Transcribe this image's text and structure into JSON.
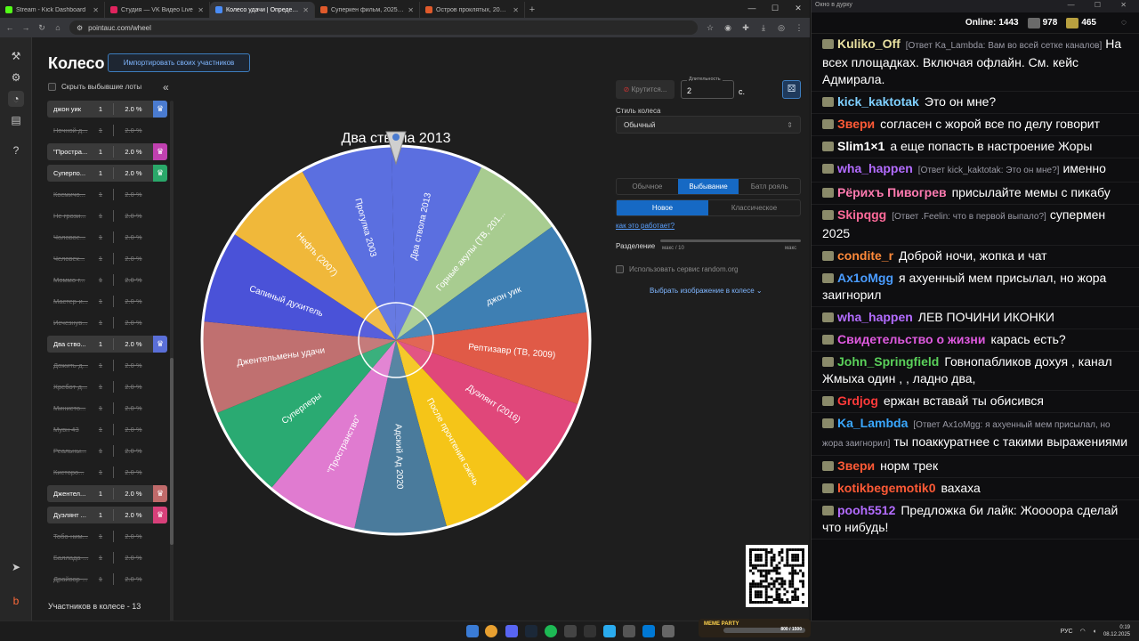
{
  "browser": {
    "tabs": [
      {
        "title": "Stream - Kick Dashboard",
        "color": "#53fc18"
      },
      {
        "title": "Студия — VK Видео Live",
        "color": "#e0245e"
      },
      {
        "title": "Колесо удачи | Определите по",
        "color": "#4a8cf7",
        "active": true
      },
      {
        "title": "Суперкен фильм, 2025, дата в",
        "color": "#e05a2b"
      },
      {
        "title": "Остров проклятых, 2009 — сю",
        "color": "#e05a2b"
      }
    ],
    "url": "pointauc.com/wheel"
  },
  "page": {
    "title": "Колесо",
    "import_button": "Импортировать своих участников",
    "hide_winners": "Скрыть выбывшие лоты",
    "footer": "Участников в колесе - 13",
    "participants": [
      {
        "name": "джон уик",
        "count": "1",
        "percent": "2.0 %",
        "active": true,
        "tag_color": "#4a7bd0"
      },
      {
        "name": "Ночной д...",
        "count": "1",
        "percent": "2.0 %",
        "active": false
      },
      {
        "name": "\"Простра...",
        "count": "1",
        "percent": "2.0 %",
        "active": true,
        "tag_color": "#c040b0"
      },
      {
        "name": "Суперпо...",
        "count": "1",
        "percent": "2.0 %",
        "active": true,
        "tag_color": "#2aa86a"
      },
      {
        "name": "Космичо...",
        "count": "1",
        "percent": "2.0 %",
        "active": false
      },
      {
        "name": "Не грози...",
        "count": "1",
        "percent": "2.0 %",
        "active": false
      },
      {
        "name": "Чоловое...",
        "count": "1",
        "percent": "2.0 %",
        "active": false
      },
      {
        "name": "Человек...",
        "count": "1",
        "percent": "2.0 %",
        "active": false
      },
      {
        "name": "Моммо-г...",
        "count": "1",
        "percent": "2.0 %",
        "active": false
      },
      {
        "name": "Мастер-и...",
        "count": "1",
        "percent": "2.0 %",
        "active": false
      },
      {
        "name": "Исчезнув...",
        "count": "1",
        "percent": "2.0 %",
        "active": false
      },
      {
        "name": "Два ство...",
        "count": "1",
        "percent": "2.0 %",
        "active": true,
        "tag_color": "#5a6fd8"
      },
      {
        "name": "Дожить-д...",
        "count": "1",
        "percent": "2.0 %",
        "active": false
      },
      {
        "name": "Хребот-д...",
        "count": "1",
        "percent": "2.0 %",
        "active": false
      },
      {
        "name": "Министо...",
        "count": "1",
        "percent": "2.0 %",
        "active": false
      },
      {
        "name": "Мувн 43",
        "count": "1",
        "percent": "2.0 %",
        "active": false
      },
      {
        "name": "Реальны...",
        "count": "1",
        "percent": "2.0 %",
        "active": false
      },
      {
        "name": "Кисторо...",
        "count": "1",
        "percent": "2.0 %",
        "active": false
      },
      {
        "name": "Джентел...",
        "count": "1",
        "percent": "2.0 %",
        "active": true,
        "tag_color": "#c06a6a"
      },
      {
        "name": "Дуэлянт ...",
        "count": "1",
        "percent": "2.0 %",
        "active": true,
        "tag_color": "#d8407a"
      },
      {
        "name": "Тобо-ним...",
        "count": "1",
        "percent": "2.0 %",
        "active": false
      },
      {
        "name": "Баллада-...",
        "count": "1",
        "percent": "2.0 %",
        "active": false
      },
      {
        "name": "Драйвор-...",
        "count": "1",
        "percent": "2.0 %",
        "active": false
      }
    ]
  },
  "wheel": {
    "title": "Два ствола 2013",
    "segments": [
      {
        "label": "Два ствола 2013",
        "color": "#5b6fe0"
      },
      {
        "label": "Горные акулы (ТВ, 201...",
        "color": "#a8cc90"
      },
      {
        "label": "джон уик",
        "color": "#3e7fb3"
      },
      {
        "label": "Рептизавр (ТВ, 2009)",
        "color": "#e05a47"
      },
      {
        "label": "Дуэлянт (2016)",
        "color": "#e0477a"
      },
      {
        "label": "После прочтения сжечь",
        "color": "#f5c518"
      },
      {
        "label": "Адский Ад 2020",
        "color": "#4a7b9c"
      },
      {
        "label": "\"Пространство\"",
        "color": "#e07bd0"
      },
      {
        "label": "Суперперы",
        "color": "#2aaa72"
      },
      {
        "label": "Джентельмены удачи",
        "color": "#c07070"
      },
      {
        "label": "Сапиный духитель",
        "color": "#4a52d8"
      },
      {
        "label": "Нефть (2007)",
        "color": "#f0b83a"
      },
      {
        "label": "Прогулка 2003",
        "color": "#5b6fe0"
      }
    ]
  },
  "controls": {
    "spin": "Крутится...",
    "duration_label": "Длительность",
    "duration_value": "2",
    "seconds": "с.",
    "style_label": "Стиль колеса",
    "style_value": "Обычный",
    "mode_tabs": [
      "Обычное",
      "Выбывание",
      "Батл рояль"
    ],
    "mode_selected": 1,
    "variant_tabs": [
      "Новое",
      "Классическое"
    ],
    "variant_selected": 0,
    "how_link": "как это работает?",
    "split_label": "Разделение",
    "split_min": "макс / 10",
    "split_max": "макс",
    "random_org": "Использовать сервис random.org",
    "select_image": "Выбрать изображение в колесе"
  },
  "chat": {
    "window_title": "Окно в дурку",
    "online_label": "Online:",
    "online": "1443",
    "stat1": "978",
    "stat2": "465",
    "messages": [
      {
        "nick": "Kuliko_Off",
        "color": "#e8e0a0",
        "reply": "[Ответ Ka_Lambda: Вам во всей сетке каналов]",
        "text": "На всех площадках. Включая офлайн. См. кейс Адмирала."
      },
      {
        "nick": "kick_kaktotak",
        "color": "#7fd0ff",
        "text": "Это он мне?"
      },
      {
        "nick": "Звери",
        "color": "#ff5a36",
        "text": "согласен с жорой все по делу говорит"
      },
      {
        "nick": "Slim1×1",
        "color": "#ffffff",
        "text": "а еще попасть в настроение Жоры"
      },
      {
        "nick": "wha_happen",
        "color": "#b36cff",
        "reply": "[Ответ kick_kaktotak: Это он мне?]",
        "text": "именно"
      },
      {
        "nick": "Рёрихъ Пивогрев",
        "color": "#ff7ab0",
        "text": "присылайте мемы с пикабу"
      },
      {
        "nick": "Skipqgg",
        "color": "#ff6a9a",
        "reply": "[Ответ .Feelin: что в первой выпало?]",
        "text": "супермен 2025"
      },
      {
        "nick": "condite_r",
        "color": "#ff8a3a",
        "text": "Доброй ночи, жопка и чат"
      },
      {
        "nick": "Ax1oMgg",
        "color": "#4a9cff",
        "text": "я ахуенный мем присылал, но жора заигнорил"
      },
      {
        "nick": "wha_happen",
        "color": "#b36cff",
        "text": "ЛЕВ ПОЧИНИ ИКОНКИ"
      },
      {
        "nick": "Свидетельство о жизни",
        "color": "#e05ae0",
        "text": "карась есть?"
      },
      {
        "nick": "John_Springfield",
        "color": "#5ad05a",
        "text": "Говнопабликов дохуя , канал Жмыха один , , ладно два,"
      },
      {
        "nick": "Grdjog",
        "color": "#ff3a3a",
        "text": "ержан вставай ты обисився"
      },
      {
        "nick": "Ka_Lambda",
        "color": "#3aa8ff",
        "reply": "[Ответ Ax1oMgg: я ахуенный мем присылал, но жора заигнорил]",
        "text": "ты поаккуратнее с такими выражениями"
      },
      {
        "nick": "Звери",
        "color": "#ff5a36",
        "text": "норм трек"
      },
      {
        "nick": "kotikbegemotik0",
        "color": "#ff5a36",
        "text": "вахаха"
      },
      {
        "nick": "pooh5512",
        "color": "#b36cff",
        "text": "Предложка би лайк: Жоооора сделай что нибудь!"
      }
    ]
  },
  "taskbar": {
    "lang": "РУС",
    "time": "0:19",
    "date": "08.12.2025",
    "meme_party": "MEME PARTY",
    "meme_progress": "800 / 1500"
  }
}
